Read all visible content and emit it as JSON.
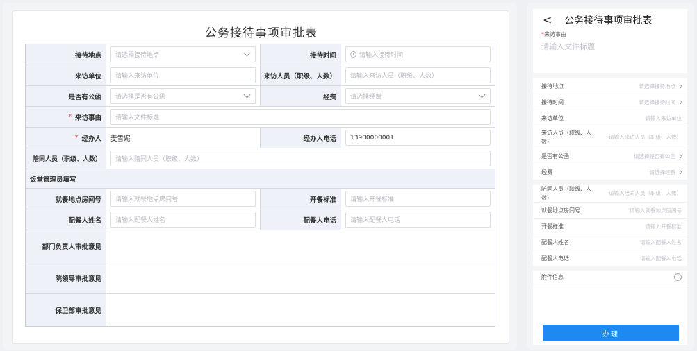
{
  "desktop": {
    "title": "公务接待事项审批表",
    "fields": {
      "reception_place": {
        "label": "接待地点",
        "placeholder": "请选择接待地点"
      },
      "reception_time": {
        "label": "接待时间",
        "placeholder": "请输入接待时间"
      },
      "visitor_unit": {
        "label": "来访单位",
        "placeholder": "请输入来访单位"
      },
      "visitors": {
        "label": "来访人员（职级、人数）",
        "placeholder": "请输入来访人员（职级、人数）"
      },
      "has_letter": {
        "label": "是否有公函",
        "placeholder": "请选择是否有公函"
      },
      "funds": {
        "label": "经费",
        "placeholder": "请选择经费"
      },
      "visit_reason": {
        "label": "来访事由",
        "placeholder": "请输入文件标题"
      },
      "handler": {
        "label": "经办人",
        "value": "麦雪妮"
      },
      "handler_phone": {
        "label": "经办人电话",
        "value": "13900000001"
      },
      "companions": {
        "label": "陪同人员（职级、人数）",
        "placeholder": "请输入陪同人员（职级、人数）"
      },
      "section_canteen": "饭堂管理员填写",
      "dining_room": {
        "label": "就餐地点房间号",
        "placeholder": "请输入就餐地点房间号"
      },
      "meal_standard": {
        "label": "开餐标准",
        "placeholder": "请输入开餐标准"
      },
      "meal_person": {
        "label": "配餐人姓名",
        "placeholder": "请输入配餐人姓名"
      },
      "meal_phone": {
        "label": "配餐人电话",
        "placeholder": "请输入配餐人电话"
      },
      "dept_opinion": {
        "label": "部门负责人审批意见"
      },
      "leader_opinion": {
        "label": "院领导审批意见"
      },
      "security_opinion": {
        "label": "保卫部审批意见"
      }
    }
  },
  "mobile": {
    "title": "公务接待事项审批表",
    "back": "<",
    "reason_label": "来访事由",
    "reason_placeholder": "请输入文件标题",
    "rows": [
      {
        "label": "接待地点",
        "placeholder": "请选择接待地点"
      },
      {
        "label": "接待时间",
        "placeholder": "请选择接待时间"
      },
      {
        "label": "来访单位",
        "placeholder": "请输入来访单位"
      },
      {
        "label": "来访人员（职级、人数）",
        "placeholder": "请输入来访人员（职级、人数）"
      },
      {
        "label": "是否有公函",
        "placeholder": "请选择是否有公函"
      },
      {
        "label": "经费",
        "placeholder": "请选择经费"
      },
      {
        "label": "陪同人员（职级、人数）",
        "placeholder": "请输入陪同人员（职级、人数）"
      },
      {
        "label": "就餐地点房间号",
        "placeholder": "请输入就餐地点房间号"
      },
      {
        "label": "开餐标准",
        "placeholder": "请输入开餐标准"
      },
      {
        "label": "配餐人姓名",
        "placeholder": "请输入配餐人姓名"
      },
      {
        "label": "配餐人电话",
        "placeholder": "请输入配餐人电话"
      },
      {
        "label": "附件信息",
        "placeholder": ""
      }
    ],
    "submit": "办理"
  }
}
